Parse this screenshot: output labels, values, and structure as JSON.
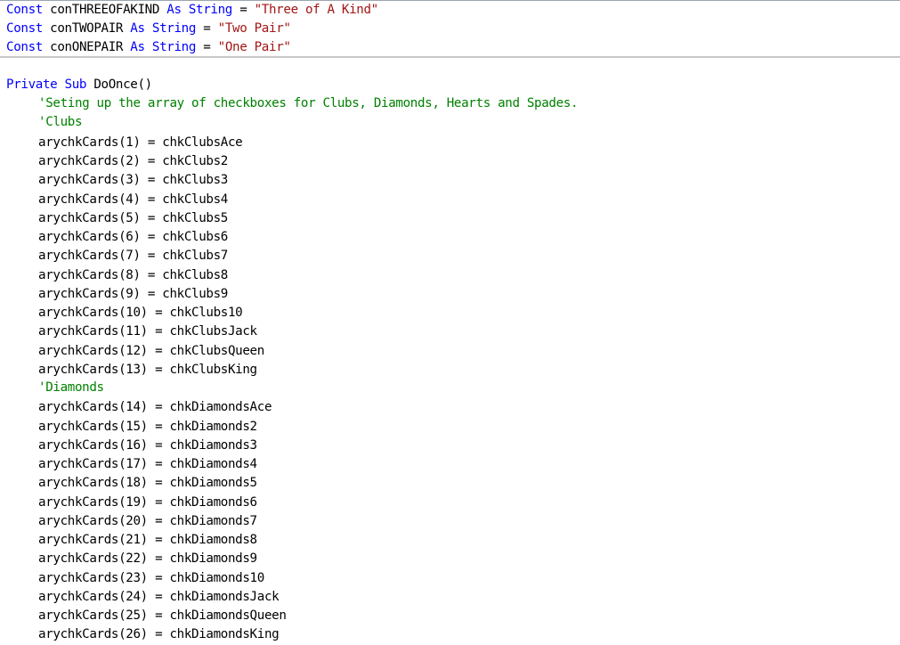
{
  "constants": [
    {
      "keyword_const": "Const",
      "name": "conTHREEOFAKIND",
      "keyword_as": "As",
      "type": "String",
      "op": "=",
      "value": "\"Three of A Kind\""
    },
    {
      "keyword_const": "Const",
      "name": "conTWOPAIR",
      "keyword_as": "As",
      "type": "String",
      "op": "=",
      "value": "\"Two Pair\""
    },
    {
      "keyword_const": "Const",
      "name": "conONEPAIR",
      "keyword_as": "As",
      "type": "String",
      "op": "=",
      "value": "\"One Pair\""
    }
  ],
  "sub": {
    "keyword_private": "Private",
    "keyword_sub": "Sub",
    "name": "DoOnce()",
    "comment_main": "'Seting up the array of checkboxes for Clubs, Diamonds, Hearts and Spades.",
    "comment_clubs": "'Clubs",
    "clubs": [
      "arychkCards(1) = chkClubsAce",
      "arychkCards(2) = chkClubs2",
      "arychkCards(3) = chkClubs3",
      "arychkCards(4) = chkClubs4",
      "arychkCards(5) = chkClubs5",
      "arychkCards(6) = chkClubs6",
      "arychkCards(7) = chkClubs7",
      "arychkCards(8) = chkClubs8",
      "arychkCards(9) = chkClubs9",
      "arychkCards(10) = chkClubs10",
      "arychkCards(11) = chkClubsJack",
      "arychkCards(12) = chkClubsQueen",
      "arychkCards(13) = chkClubsKing"
    ],
    "comment_diamonds": "'Diamonds",
    "diamonds": [
      "arychkCards(14) = chkDiamondsAce",
      "arychkCards(15) = chkDiamonds2",
      "arychkCards(16) = chkDiamonds3",
      "arychkCards(17) = chkDiamonds4",
      "arychkCards(18) = chkDiamonds5",
      "arychkCards(19) = chkDiamonds6",
      "arychkCards(20) = chkDiamonds7",
      "arychkCards(21) = chkDiamonds8",
      "arychkCards(22) = chkDiamonds9",
      "arychkCards(23) = chkDiamonds10",
      "arychkCards(24) = chkDiamondsJack",
      "arychkCards(25) = chkDiamondsQueen",
      "arychkCards(26) = chkDiamondsKing"
    ]
  },
  "colors": {
    "keyword": "#0000ff",
    "string": "#a31515",
    "comment": "#008000",
    "identifier": "#000000"
  }
}
